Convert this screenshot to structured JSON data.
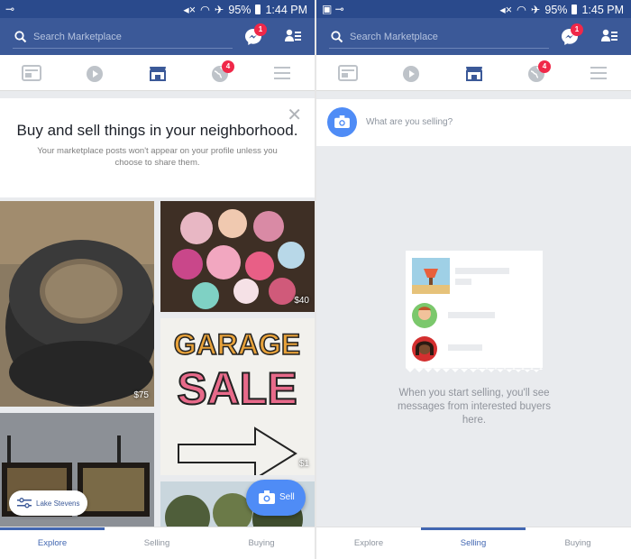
{
  "screen_left": {
    "status": {
      "battery": "95%",
      "time": "1:44 PM"
    },
    "search": {
      "placeholder": "Search Marketplace"
    },
    "badges": {
      "messenger": "1",
      "notifications": "4"
    },
    "hero": {
      "title": "Buy and sell things in your neighborhood.",
      "subtitle": "Your marketplace posts won't appear on your profile unless you choose to share them."
    },
    "listings": [
      {
        "name": "tires",
        "price": "$75"
      },
      {
        "name": "clothes",
        "price": "$40"
      },
      {
        "name": "garage-sale-sign",
        "price": "$1"
      },
      {
        "name": "framed-pictures",
        "price": ""
      },
      {
        "name": "trees",
        "price": ""
      }
    ],
    "location_filter": "Lake Stevens",
    "sell_button": "Sell",
    "tabs": [
      "Explore",
      "Selling",
      "Buying"
    ],
    "active_tab": "Explore"
  },
  "screen_right": {
    "status": {
      "battery": "95%",
      "time": "1:45 PM"
    },
    "search": {
      "placeholder": "Search Marketplace"
    },
    "badges": {
      "messenger": "1",
      "notifications": "4"
    },
    "sell_prompt": "What are you selling?",
    "empty_message": "When you start selling, you'll see messages from interested buyers here.",
    "tabs": [
      "Explore",
      "Selling",
      "Buying"
    ],
    "active_tab": "Selling"
  },
  "colors": {
    "header": "#3b5998",
    "status_bar": "#2a4a8c",
    "accent": "#4267b2",
    "sell_blue": "#4f8cf6",
    "badge": "#f02849"
  }
}
